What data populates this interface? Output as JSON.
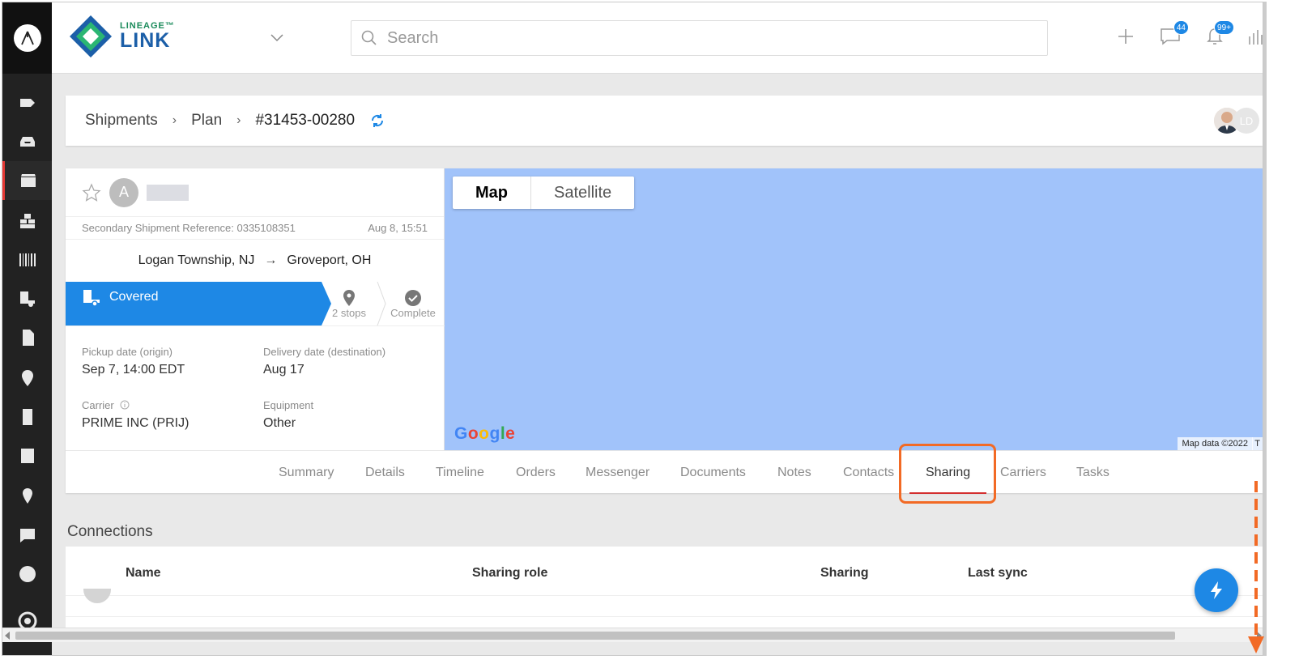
{
  "header": {
    "brand_small": "LINEAGE™",
    "brand_big": "LINK",
    "search_placeholder": "Search",
    "chat_badge": "44",
    "notif_badge": "99+"
  },
  "breadcrumb": {
    "items": [
      "Shipments",
      "Plan",
      "#31453-00280"
    ],
    "avatar_initials": "LD"
  },
  "shipment": {
    "avatar_initial": "A",
    "secondary_ref": "Secondary Shipment Reference: 0335108351",
    "date": "Aug 8, 15:51",
    "origin": "Logan Township, NJ",
    "arrow": "→",
    "destination": "Groveport, OH",
    "status": "Covered",
    "stops": "2 stops",
    "complete": "Complete",
    "pickup_label": "Pickup date (origin)",
    "pickup_value": "Sep 7, 14:00 EDT",
    "delivery_label": "Delivery date (destination)",
    "delivery_value": "Aug 17",
    "carrier_label": "Carrier",
    "carrier_value": "PRIME INC (PRIJ)",
    "equipment_label": "Equipment",
    "equipment_value": "Other"
  },
  "map": {
    "toggle_map": "Map",
    "toggle_satellite": "Satellite",
    "attribution": "Map data ©2022",
    "attribution_cut": "T",
    "logo_text": "Google"
  },
  "tabs": [
    "Summary",
    "Details",
    "Timeline",
    "Orders",
    "Messenger",
    "Documents",
    "Notes",
    "Contacts",
    "Sharing",
    "Carriers",
    "Tasks"
  ],
  "active_tab": "Sharing",
  "connections": {
    "title": "Connections",
    "columns": [
      "Name",
      "Sharing role",
      "Sharing",
      "Last sync"
    ]
  },
  "colors": {
    "accent_blue": "#1e88e5",
    "highlight_orange": "#f26a25",
    "map_blue": "#a1c3fa",
    "rail_dark": "#222222"
  }
}
